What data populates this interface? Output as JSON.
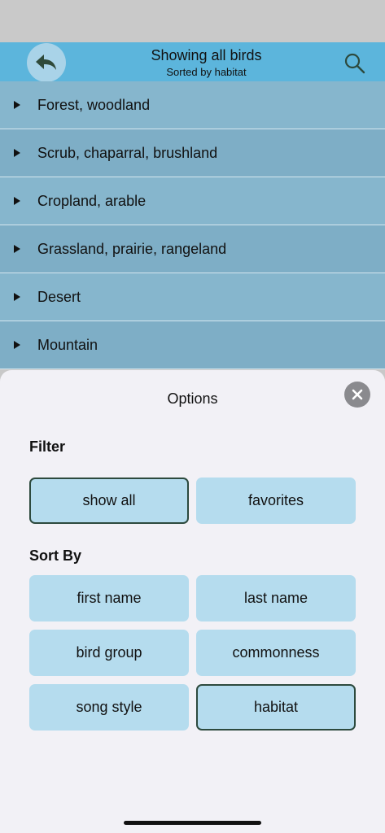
{
  "header": {
    "title": "Showing all birds",
    "subtitle": "Sorted by habitat",
    "back_icon": "undo-arrow-icon",
    "search_icon": "search-icon"
  },
  "habitats": [
    "Forest, woodland",
    "Scrub, chaparral, brushland",
    "Cropland, arable",
    "Grassland, prairie, rangeland",
    "Desert",
    "Mountain"
  ],
  "options": {
    "title": "Options",
    "filter_label": "Filter",
    "filter": [
      {
        "label": "show all",
        "selected": true
      },
      {
        "label": "favorites",
        "selected": false
      }
    ],
    "sort_label": "Sort By",
    "sort": [
      {
        "label": "first name",
        "selected": false
      },
      {
        "label": "last name",
        "selected": false
      },
      {
        "label": "bird group",
        "selected": false
      },
      {
        "label": "commonness",
        "selected": false
      },
      {
        "label": "song style",
        "selected": false
      },
      {
        "label": "habitat",
        "selected": true
      }
    ]
  },
  "colors": {
    "header": "#5cb5dc",
    "row": "#86b6cd",
    "option_button": "#b5dcee",
    "selected_border": "#2d4a3e"
  }
}
